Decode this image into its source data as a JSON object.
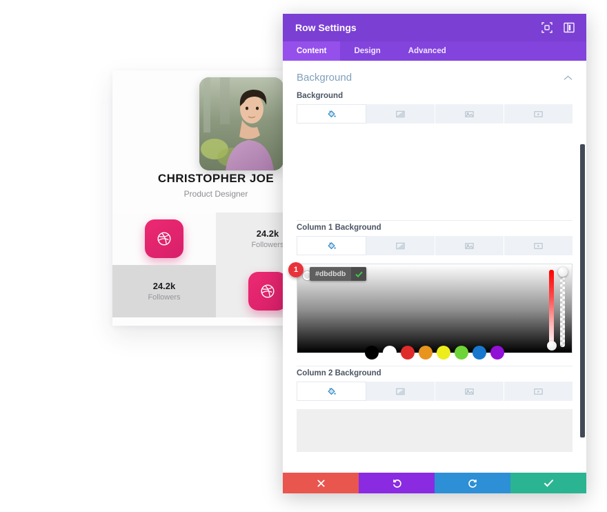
{
  "preview": {
    "person_name": "CHRISTOPHER JOE",
    "person_role": "Product Designer",
    "avatar_icon": "person-photo",
    "stats": [
      {
        "type": "icon",
        "icon": "dribbble-icon"
      },
      {
        "type": "stat",
        "value": "24.2k",
        "label": "Followers"
      },
      {
        "type": "stat",
        "value": "24.2k",
        "label": "Followers"
      },
      {
        "type": "icon",
        "icon": "dribbble-icon"
      }
    ],
    "accent_color": "#ec2a72"
  },
  "panel": {
    "title": "Row Settings",
    "header_icons": [
      {
        "name": "expand-icon"
      },
      {
        "name": "layout-toggle-icon"
      }
    ],
    "tabs": [
      {
        "label": "Content",
        "active": true
      },
      {
        "label": "Design",
        "active": false
      },
      {
        "label": "Advanced",
        "active": false
      }
    ],
    "section": {
      "title": "Background",
      "collapse_icon": "chevron-up-icon"
    },
    "fields": {
      "background_label": "Background",
      "column1_label": "Column 1 Background",
      "column2_label": "Column 2 Background"
    },
    "bg_types": [
      {
        "name": "color-tab",
        "icon": "paint-bucket-icon",
        "active": true
      },
      {
        "name": "gradient-tab",
        "icon": "gradient-icon",
        "active": false
      },
      {
        "name": "image-tab",
        "icon": "image-icon",
        "active": false
      },
      {
        "name": "video-tab",
        "icon": "video-icon",
        "active": false
      }
    ],
    "color_picker": {
      "step_badge": "1",
      "hex_value": "#dbdbdb",
      "confirm_icon": "check-icon",
      "swatches": [
        "#000000",
        "#ffffff",
        "#e02b2b",
        "#e8941e",
        "#eded1c",
        "#6fd437",
        "#1878cd",
        "#9112d6"
      ],
      "hue_color": "#ff0000"
    },
    "actions": [
      {
        "name": "close-button",
        "icon": "x-icon",
        "color": "#e8564e"
      },
      {
        "name": "undo-button",
        "icon": "undo-icon",
        "color": "#8a2be2"
      },
      {
        "name": "redo-button",
        "icon": "redo-icon",
        "color": "#2d8fd5"
      },
      {
        "name": "save-button",
        "icon": "check-icon",
        "color": "#2bb492"
      }
    ]
  }
}
